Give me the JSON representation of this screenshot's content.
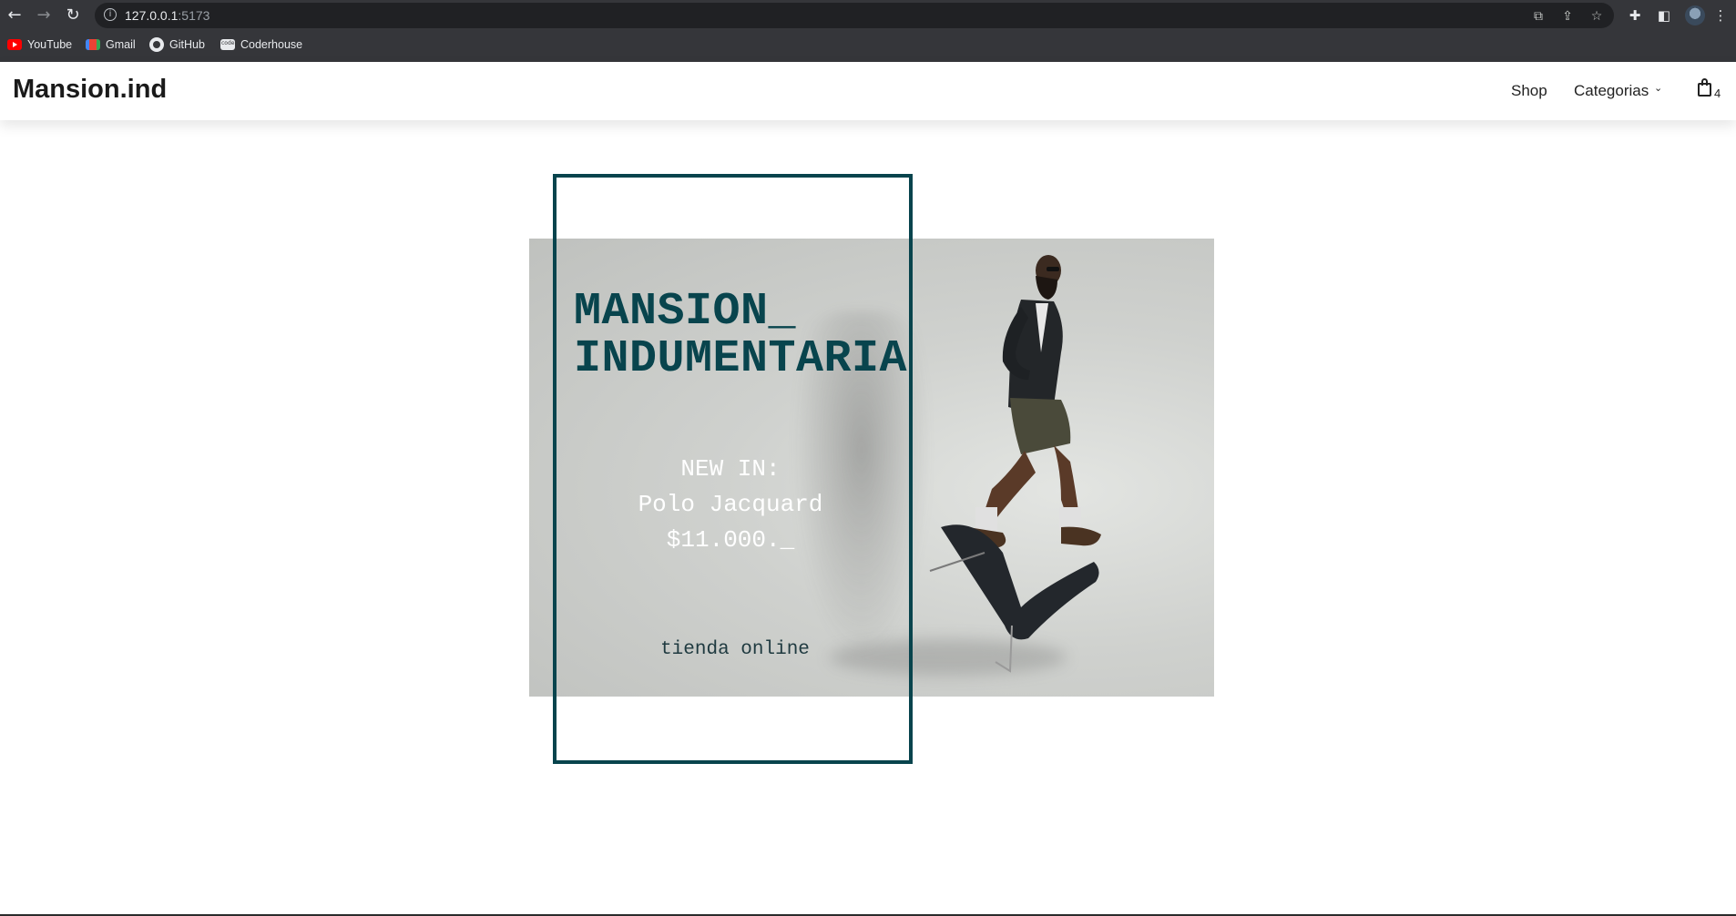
{
  "browser": {
    "url_host": "127.0.0.1",
    "url_port": ":5173",
    "bookmarks": [
      {
        "label": "YouTube",
        "icon": "youtube-icon"
      },
      {
        "label": "Gmail",
        "icon": "gmail-icon"
      },
      {
        "label": "GitHub",
        "icon": "github-icon"
      },
      {
        "label": "Coderhouse",
        "icon": "coderhouse-icon"
      }
    ]
  },
  "navbar": {
    "brand": "Mansion.ind",
    "links": {
      "shop": "Shop",
      "categories": "Categorias"
    },
    "cart_count": "4"
  },
  "hero": {
    "title_line1": "MANSION_",
    "title_line2": "INDUMENTARIA",
    "promo_line1": "NEW IN:",
    "promo_line2": "Polo Jacquard",
    "promo_line3": "$11.000._",
    "tagline": "tienda online"
  },
  "colors": {
    "accent": "#08444d",
    "chrome_bg": "#35363a",
    "hero_bg": "#c9cbc8"
  }
}
